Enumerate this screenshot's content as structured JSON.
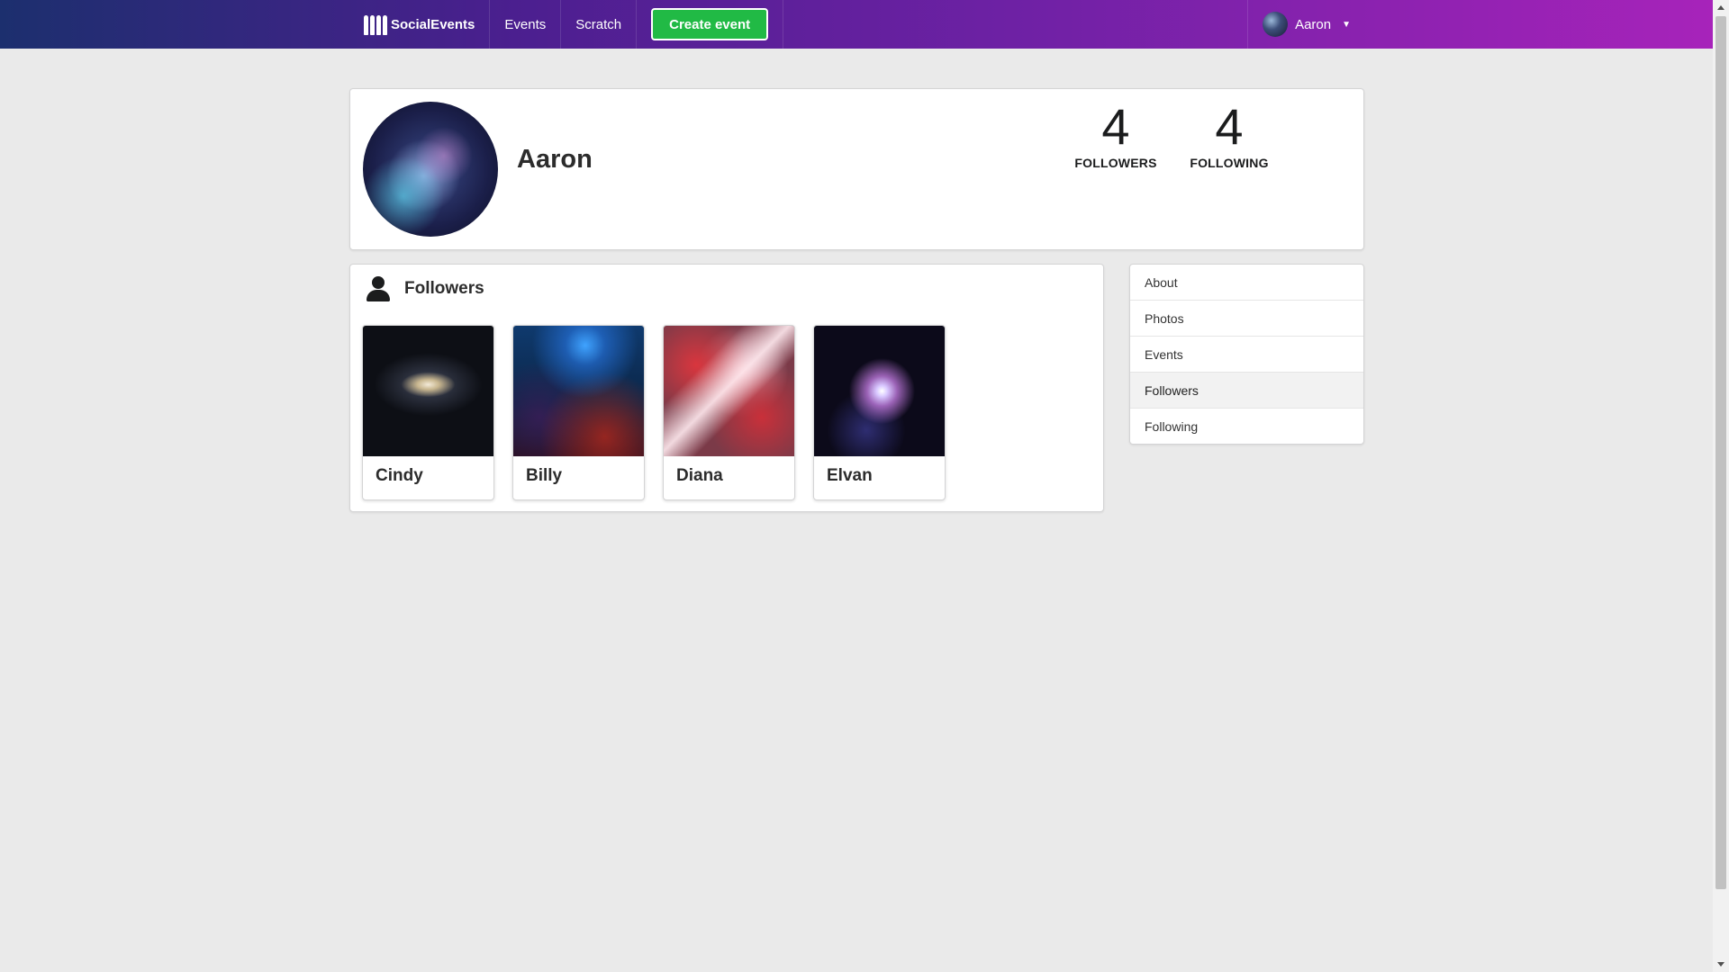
{
  "nav": {
    "brand": "SocialEvents",
    "links": [
      "Events",
      "Scratch"
    ],
    "create_label": "Create event",
    "user_name": "Aaron",
    "gradient_start": "#1c2f6e",
    "gradient_end": "#a723ba",
    "create_color": "#21ba45"
  },
  "profile": {
    "name": "Aaron",
    "followers_count": "4",
    "followers_label": "FOLLOWERS",
    "following_count": "4",
    "following_label": "FOLLOWING"
  },
  "followers_panel": {
    "title": "Followers",
    "icon": "user-icon",
    "people": [
      {
        "name": "Cindy"
      },
      {
        "name": "Billy"
      },
      {
        "name": "Diana"
      },
      {
        "name": "Elvan"
      }
    ]
  },
  "side_menu": {
    "items": [
      "About",
      "Photos",
      "Events",
      "Followers",
      "Following"
    ],
    "active": "Followers"
  }
}
